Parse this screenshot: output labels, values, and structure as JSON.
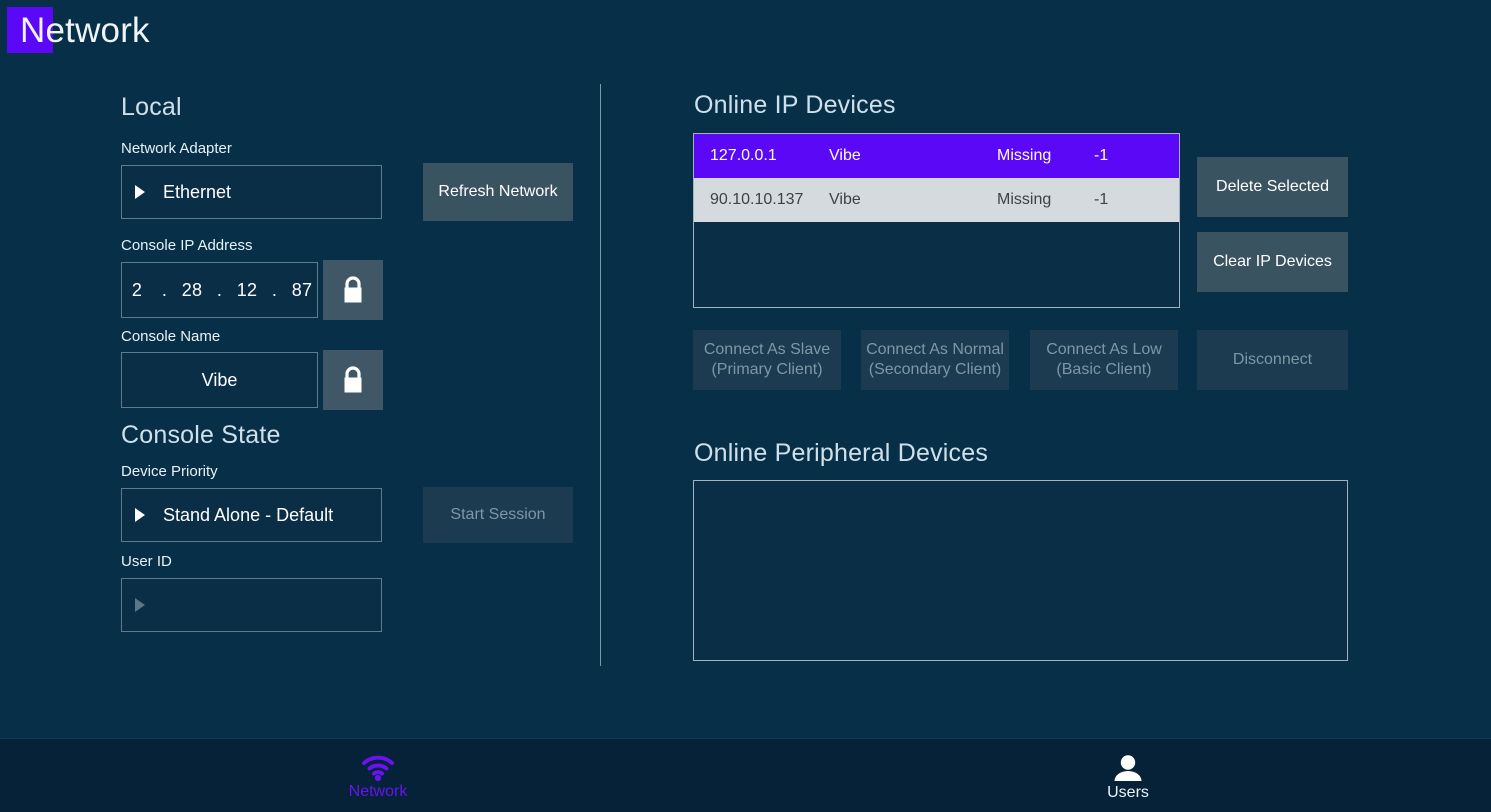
{
  "header": {
    "title": "Network",
    "badge_color": "#5a08f5"
  },
  "left_panel": {
    "local_heading": "Local",
    "network_adapter": {
      "label": "Network Adapter",
      "value": "Ethernet"
    },
    "console_ip": {
      "label": "Console IP Address",
      "octets": [
        "2",
        "28",
        "12",
        "87"
      ],
      "separator": ".",
      "lock_icon": "lock-closed-icon"
    },
    "console_name": {
      "label": "Console Name",
      "value": "Vibe",
      "lock_icon": "lock-closed-icon"
    },
    "console_state_heading": "Console State",
    "device_priority": {
      "label": "Device Priority",
      "value": "Stand Alone - Default"
    },
    "user_id": {
      "label": "User ID",
      "value": ""
    },
    "refresh_button": "Refresh Network",
    "start_session_button": "Start Session"
  },
  "right_panel": {
    "ip_devices_heading": "Online IP Devices",
    "ip_devices": [
      {
        "ip": "127.0.0.1",
        "name": "Vibe",
        "status": "Missing",
        "value": "-1",
        "selected": true
      },
      {
        "ip": "90.10.10.137",
        "name": "Vibe",
        "status": "Missing",
        "value": "-1",
        "selected": false
      }
    ],
    "delete_selected_button": "Delete Selected",
    "clear_ip_devices_button": "Clear IP Devices",
    "connect_buttons": [
      {
        "line1": "Connect As Slave",
        "line2": "(Primary Client)"
      },
      {
        "line1": "Connect As Normal",
        "line2": "(Secondary Client)"
      },
      {
        "line1": "Connect As Low",
        "line2": "(Basic Client)"
      }
    ],
    "disconnect_button": "Disconnect",
    "peripheral_heading": "Online Peripheral Devices",
    "peripheral_devices": []
  },
  "bottom_nav": {
    "items": [
      {
        "label": "Network",
        "icon": "wifi-icon",
        "active": true
      },
      {
        "label": "Users",
        "icon": "user-icon",
        "active": false
      }
    ]
  }
}
